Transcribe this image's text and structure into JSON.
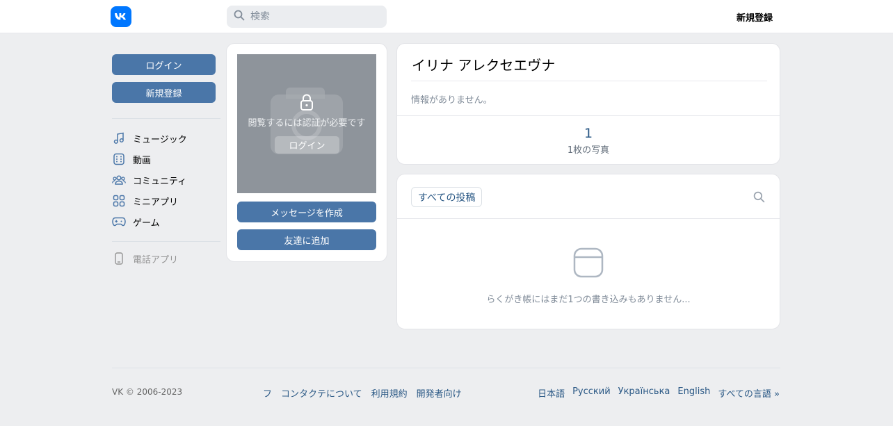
{
  "header": {
    "search_placeholder": "検索",
    "register_label": "新規登録"
  },
  "sidebar": {
    "login_label": "ログイン",
    "register_label": "新規登録",
    "items": [
      {
        "label": "ミュージック",
        "icon": "music-icon"
      },
      {
        "label": "動画",
        "icon": "video-icon"
      },
      {
        "label": "コミュニティ",
        "icon": "community-icon"
      },
      {
        "label": "ミニアプリ",
        "icon": "mini-apps-icon"
      },
      {
        "label": "ゲーム",
        "icon": "gamepad-icon"
      }
    ],
    "phone_app_label": "電話アプリ"
  },
  "photo_card": {
    "auth_notice": "閲覧するには認証が必要です",
    "photo_login_label": "ログイン",
    "message_button": "メッセージを作成",
    "add_friend_button": "友達に追加"
  },
  "profile": {
    "name": "イリナ アレクセエヴナ",
    "info": "情報がありません。",
    "photo_count": "1",
    "photo_count_label": "1枚の写真"
  },
  "wall": {
    "filter_label": "すべての投稿",
    "empty_text": "らくがき帳にはまだ1つの書き込みもありません..."
  },
  "footer": {
    "copyright": "VK © 2006-2023",
    "links": [
      "フ",
      "コンタクテについて",
      "利用規約",
      "開発者向け"
    ],
    "languages": [
      "日本語",
      "Русский",
      "Українська",
      "English",
      "すべての言語 »"
    ]
  },
  "colors": {
    "brand": "#0077ff",
    "button": "#4a76a8",
    "link": "#2a5885",
    "background": "#edeef0"
  }
}
